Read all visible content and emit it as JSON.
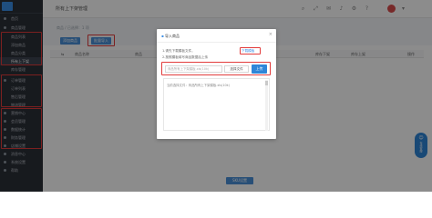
{
  "sidebar": {
    "items": [
      {
        "label": "首页"
      },
      {
        "label": "商品管理"
      },
      {
        "label": "商品列表"
      },
      {
        "label": "添加商品"
      },
      {
        "label": "商品分类"
      },
      {
        "label": "所有上下架"
      },
      {
        "label": "库存管理"
      },
      {
        "label": "订单管理"
      },
      {
        "label": "订单列表"
      },
      {
        "label": "售后管理"
      },
      {
        "label": "物流管理"
      },
      {
        "label": "营销中心"
      },
      {
        "label": "会员管理"
      },
      {
        "label": "数据统计"
      },
      {
        "label": "财务管理"
      },
      {
        "label": "店铺设置"
      },
      {
        "label": "消息中心"
      },
      {
        "label": "系统设置"
      },
      {
        "label": "帮助"
      }
    ]
  },
  "header": {
    "title": "所有上下架管理"
  },
  "toolbar": {
    "add_label": "添加商品",
    "import_label": "批量导入",
    "breadcrumb": "商品 / 已选择：1 项"
  },
  "table": {
    "headers": [
      "商品名称",
      "商品",
      "库存下架",
      "库存上架",
      "操作"
    ]
  },
  "footer": {
    "confirm_label": "SKU设置"
  },
  "modal": {
    "title": "导入商品",
    "step1": "1.请先下载模板文件，",
    "download_label": "下载模板",
    "step2": "2.按照模板填写商品数据后上传",
    "file_placeholder": "商品所有上下架模板.xls(10k)",
    "choose_label": "选择文件",
    "upload_label": "上传",
    "result_text": "当前选择文件：商品所有上下架模板.xls(10k)"
  },
  "float": {
    "label": "在线客服"
  }
}
